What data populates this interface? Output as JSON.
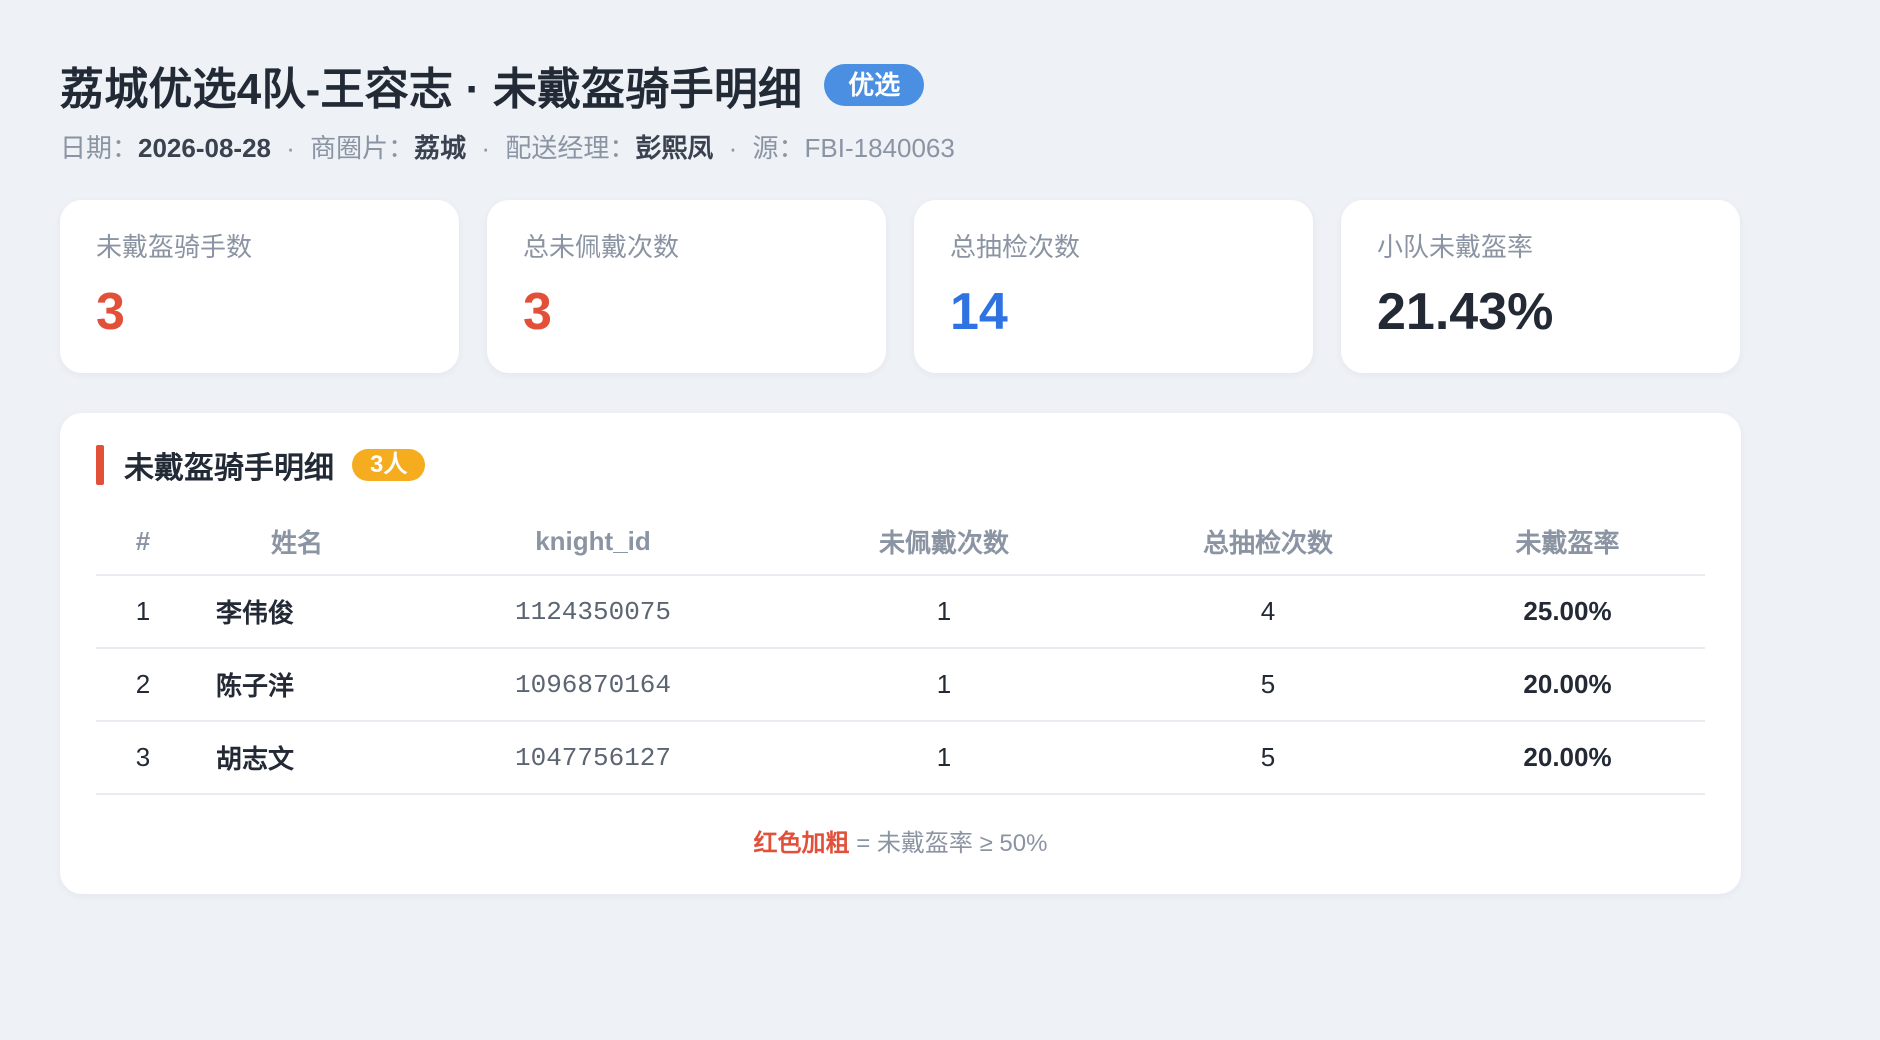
{
  "header": {
    "title": "荔城优选4队-王容志 · 未戴盔骑手明细",
    "badge": "优选",
    "meta": {
      "date_label": "日期：",
      "date_value": "2026-08-28",
      "area_label": "商圈片：",
      "area_value": "荔城",
      "manager_label": "配送经理：",
      "manager_value": "彭熙凤",
      "source_label": "源：",
      "source_value": "FBI-1840063",
      "separator": "·"
    }
  },
  "stats": [
    {
      "label": "未戴盔骑手数",
      "value": "3",
      "color": "#e2503a"
    },
    {
      "label": "总未佩戴次数",
      "value": "3",
      "color": "#e2503a"
    },
    {
      "label": "总抽检次数",
      "value": "14",
      "color": "#2f73e3"
    },
    {
      "label": "小队未戴盔率",
      "value": "21.43%",
      "color": "#232a35"
    }
  ],
  "detail": {
    "title": "未戴盔骑手明细",
    "count_badge": "3人",
    "columns": [
      "#",
      "姓名",
      "knight_id",
      "未佩戴次数",
      "总抽检次数",
      "未戴盔率"
    ],
    "rows": [
      {
        "no": "1",
        "name": "李伟俊",
        "knight_id": "1124350075",
        "missed": "1",
        "checks": "4",
        "rate": "25.00%"
      },
      {
        "no": "2",
        "name": "陈子洋",
        "knight_id": "1096870164",
        "missed": "1",
        "checks": "5",
        "rate": "20.00%"
      },
      {
        "no": "3",
        "name": "胡志文",
        "knight_id": "1047756127",
        "missed": "1",
        "checks": "5",
        "rate": "20.00%"
      }
    ],
    "legend_highlight": "红色加粗",
    "legend_text": " = 未戴盔率 ≥ 50%"
  },
  "colors": {
    "accent_red": "#e2503a",
    "accent_blue": "#2f73e3",
    "badge_blue": "#4a8fe2",
    "badge_orange": "#f5ac1e"
  }
}
